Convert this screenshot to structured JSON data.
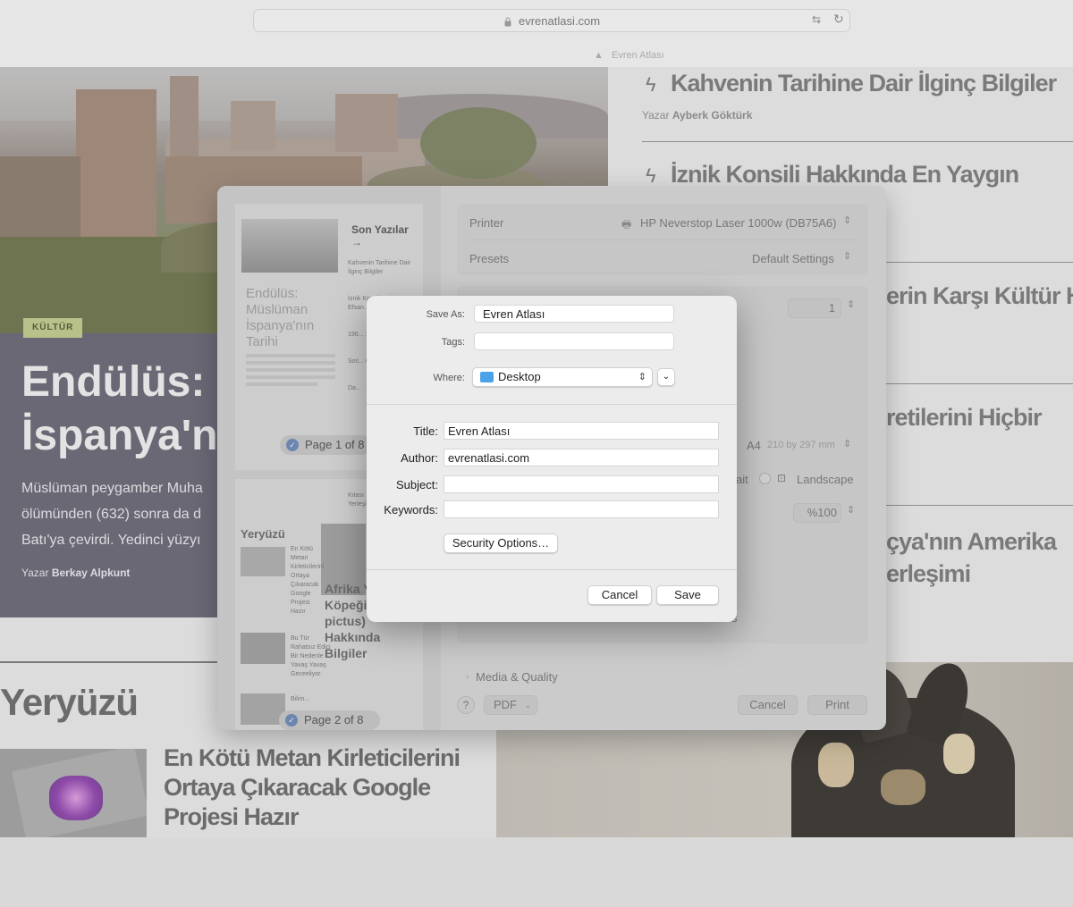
{
  "browser": {
    "url": "evrenatlasi.com",
    "tab_title": "Evren Atlası",
    "icons": {
      "lock": "lock-icon",
      "translate": "translate-icon",
      "reload": "reload-icon"
    }
  },
  "page": {
    "hero": {
      "category": "KÜLTÜR",
      "title_line1": "Endülüs: İ",
      "title_line2": "İspanya'nı",
      "excerpt_lines": [
        "Müslüman peygamber Muha",
        "ölümünden (632) sonra da d",
        "Batı'ya çevirdi. Yedinci yüzyı"
      ],
      "author_prefix": "Yazar",
      "author_name": "Berkay Alpkunt"
    },
    "sidebar": [
      {
        "title": "Kahvenin Tarihine Dair İlginç Bilgiler",
        "author_prefix": "Yazar",
        "author_name": "Ayberk Göktürk"
      },
      {
        "title": "İznik Konsili Hakkında En Yaygın"
      },
      {
        "title": "erin Karşı Kültür Hip"
      },
      {
        "title": "retilerini Hiçbir"
      },
      {
        "title_line1": "çya'nın Amerika",
        "title_line2": "erleşimi"
      }
    ],
    "section_heading": "Yeryüzü",
    "article": {
      "title": "En Kötü Metan Kirleticilerini Ortaya Çıkaracak Google Projesi Hazır"
    }
  },
  "print_panel": {
    "preview1": {
      "section": "Son Yazılar →",
      "items": [
        "Kahvenin Tarihine Dair İlginç Bilgiler",
        "İznik Konsili Hakk... Efsan...",
        "196... 1970'... Hippi",
        "Sos... Öğre... Zama...",
        "Da..."
      ],
      "hero_title": "Endülüs: Müslüman İspanya'nın Tarihi",
      "page_label": "Page 1 of 8"
    },
    "preview2": {
      "section": "Yeryüzü",
      "items": [
        "En Kötü Metan Kirleticilerini Ortaya Çıkaracak Google Projesi Hazır",
        "Bu Tür Rahatsız Edici Bir Nedenle Yavaş Yavaş Geceeliyor",
        "Bilim..."
      ],
      "big_title": "Afrika Yaban Köpeği (Lycaon pictus) Hakkında Bilgiler",
      "side_text": "Kıtası Yerleşimi",
      "page_label": "Page 2 of 8"
    },
    "printer_label": "Printer",
    "printer_value": "HP Neverstop Laser 1000w (DB75A6)",
    "presets_label": "Presets",
    "presets_value": "Default Settings",
    "copies_value": "1",
    "paper_value": "A4",
    "paper_size": "210 by 297 mm",
    "orientation_partial": "ait",
    "landscape_label": "Landscape",
    "scale_value": "%100",
    "partial_s": "s",
    "media_quality": "Media & Quality",
    "help": "?",
    "pdf_label": "PDF",
    "cancel_label": "Cancel",
    "print_label": "Print"
  },
  "save_dialog": {
    "save_as_label": "Save As:",
    "save_as_value": "Evren Atlası",
    "tags_label": "Tags:",
    "tags_value": "",
    "where_label": "Where:",
    "where_value": "Desktop",
    "title_label": "Title:",
    "title_value": "Evren Atlası",
    "author_label": "Author:",
    "author_value": "evrenatlasi.com",
    "subject_label": "Subject:",
    "subject_value": "",
    "keywords_label": "Keywords:",
    "keywords_value": "",
    "security_button": "Security Options…",
    "cancel_button": "Cancel",
    "save_button": "Save",
    "folder_icon": "folder-icon",
    "chevron_icon": "chevron-down-icon"
  }
}
